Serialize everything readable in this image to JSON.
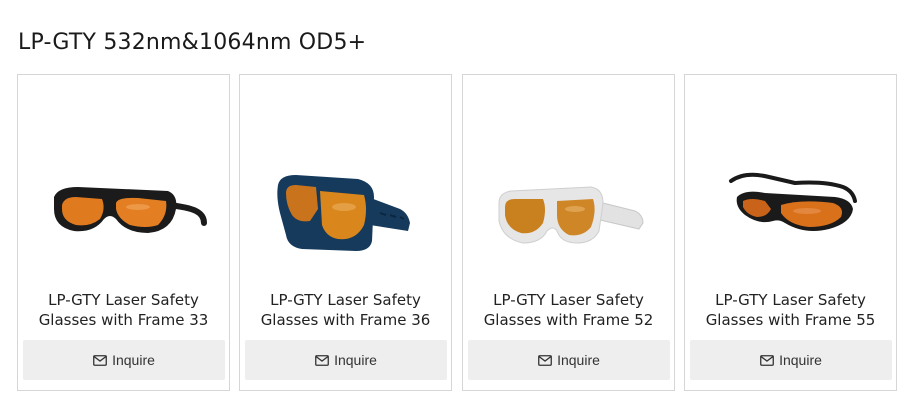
{
  "section": {
    "title": "LP-GTY 532nm&1064nm OD5+"
  },
  "products": [
    {
      "title": "LP-GTY Laser Safety Glasses with Frame 33",
      "button_label": "Inquire",
      "icon": "mail-icon",
      "frame_color": "#1b1b1b",
      "lens_color": "#e07a1f"
    },
    {
      "title": "LP-GTY Laser Safety Glasses with Frame 36",
      "button_label": "Inquire",
      "icon": "mail-icon",
      "frame_color": "#163a5c",
      "lens_color": "#d9861c"
    },
    {
      "title": "LP-GTY Laser Safety Glasses with Frame 52",
      "button_label": "Inquire",
      "icon": "mail-icon",
      "frame_color": "#dcdcdc",
      "lens_color": "#c9801f"
    },
    {
      "title": "LP-GTY Laser Safety Glasses with Frame 55",
      "button_label": "Inquire",
      "icon": "mail-icon",
      "frame_color": "#1a1a1a",
      "lens_color": "#d9701a"
    }
  ]
}
